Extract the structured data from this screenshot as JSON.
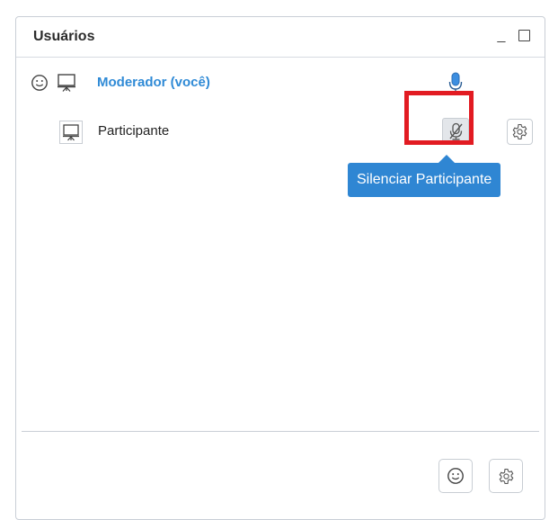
{
  "panel": {
    "title": "Usuários",
    "minimize_glyph": "_",
    "maximize_glyph": "□"
  },
  "users": [
    {
      "name": "Moderador (você)",
      "role": "moderator",
      "icons": [
        "smiley-icon",
        "presenter-screen-icon",
        "microphone-icon"
      ]
    },
    {
      "name": "Participante",
      "role": "participant",
      "icons": [
        "presenter-screen-icon",
        "microphone-muted-icon",
        "gear-icon"
      ]
    }
  ],
  "tooltip": {
    "text": "Silenciar Participante"
  },
  "footer": {
    "buttons": [
      "smiley-icon",
      "gear-icon"
    ]
  },
  "colors": {
    "accent": "#2f86d3",
    "moderator_name": "#2f8ad6",
    "highlight": "#e21b22",
    "border": "#c9ced6"
  }
}
